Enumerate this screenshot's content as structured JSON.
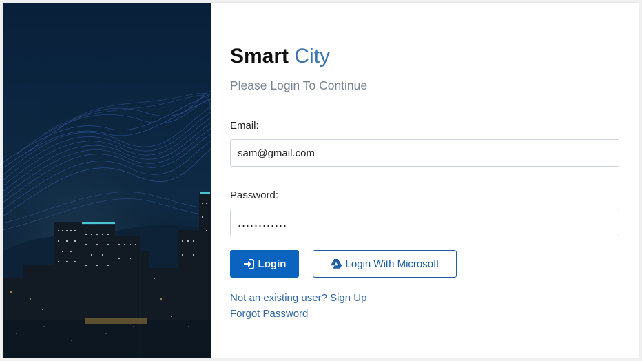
{
  "brand": {
    "title_bold": "Smart",
    "title_accent": "City",
    "subtitle": "Please Login To Continue"
  },
  "form": {
    "email_label": "Email:",
    "email_value": "sam@gmail.com",
    "password_label": "Password:",
    "password_value": "............",
    "login_button": "Login",
    "microsoft_button": "Login With Microsoft"
  },
  "links": {
    "signup": "Not an existing user? Sign Up",
    "forgot": "Forgot Password"
  },
  "colors": {
    "accent": "#3d73b5",
    "primary_button": "#0b63c0",
    "link": "#2f67a8"
  },
  "icons": {
    "login": "sign-in-icon",
    "microsoft": "drive-icon",
    "hero": "city-skyline-image"
  }
}
